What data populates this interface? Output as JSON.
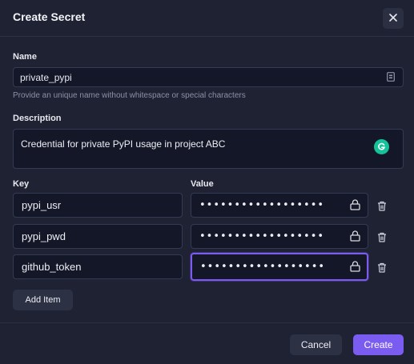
{
  "dialog": {
    "title": "Create Secret",
    "close_icon": "close-icon"
  },
  "name": {
    "label": "Name",
    "value": "private_pypi",
    "hint": "Provide an unique name without whitespace or special characters",
    "field_icon": "text-field-icon"
  },
  "description": {
    "label": "Description",
    "value": "Credential for private PyPI usage in project ABC",
    "assistant_icon": "grammarly-icon"
  },
  "items": {
    "key_label": "Key",
    "value_label": "Value",
    "rows": [
      {
        "key": "pypi_usr",
        "value": "••••••••••••••••••"
      },
      {
        "key": "pypi_pwd",
        "value": "••••••••••••••••••"
      },
      {
        "key": "github_token",
        "value": "••••••••••••••••••"
      }
    ],
    "lock_icon": "lock-icon",
    "delete_icon": "trash-icon",
    "add_label": "Add Item"
  },
  "footer": {
    "cancel_label": "Cancel",
    "create_label": "Create"
  },
  "colors": {
    "accent": "#7b5cf0",
    "background": "#1f2233",
    "input_bg": "#141728",
    "grammarly": "#15c39a"
  }
}
